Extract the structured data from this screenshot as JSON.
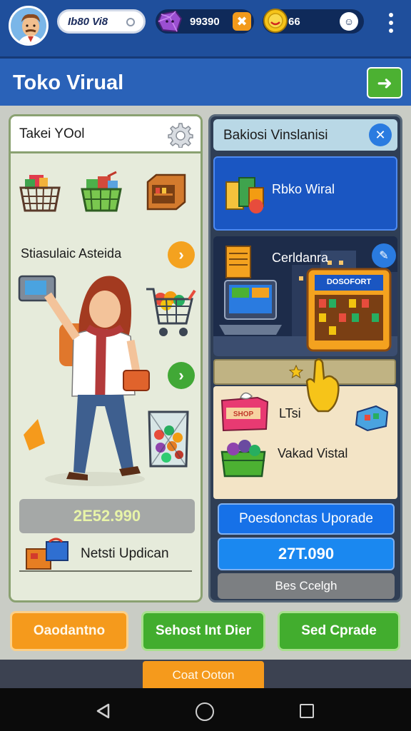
{
  "topbar": {
    "player_name": "Ib80 Vi8",
    "gems": "99390",
    "coins": "66",
    "icons": {
      "avatar": "shopkeeper-avatar",
      "gem": "purple-gem-icon",
      "coin": "gold-coin-icon",
      "add": "add-gems-icon",
      "profile": "face-icon",
      "menu": "kebab-menu-icon"
    }
  },
  "header": {
    "title": "Toko Virual",
    "action_icon": "green-action-icon"
  },
  "left_panel": {
    "title": "Takei YOol",
    "subtitle": "Stiasulaic Asteida",
    "price": "2E52.990",
    "upgrade_label": "Netsti Updican",
    "icons": [
      "gear-icon",
      "basket-icon",
      "shopping-cart-icon",
      "shelf-icon",
      "jar-icon"
    ]
  },
  "right_panel": {
    "title": "Bakiosi Vinslanisi",
    "card1_label": "Rbko Wiral",
    "card2_label": "Cerldanra",
    "store_sign": "DOSOFORT",
    "item1_label": "LTsi",
    "item2_label": "Vakad Vistal",
    "upgrade_button": "Poesdonctas Uporade",
    "value": "27T.090",
    "best_button": "Bes Ccelgh"
  },
  "bottom": {
    "btn1": "Oaodantno",
    "btn2": "Sehost Int Dier",
    "btn3": "Sed Cprade",
    "dock": "Coat Ooton"
  },
  "colors": {
    "top_bar": "#1f4f9c",
    "title_bar": "#2a62b8",
    "orange": "#f59a1c",
    "green": "#42ad2e",
    "blue": "#1a88f0"
  }
}
